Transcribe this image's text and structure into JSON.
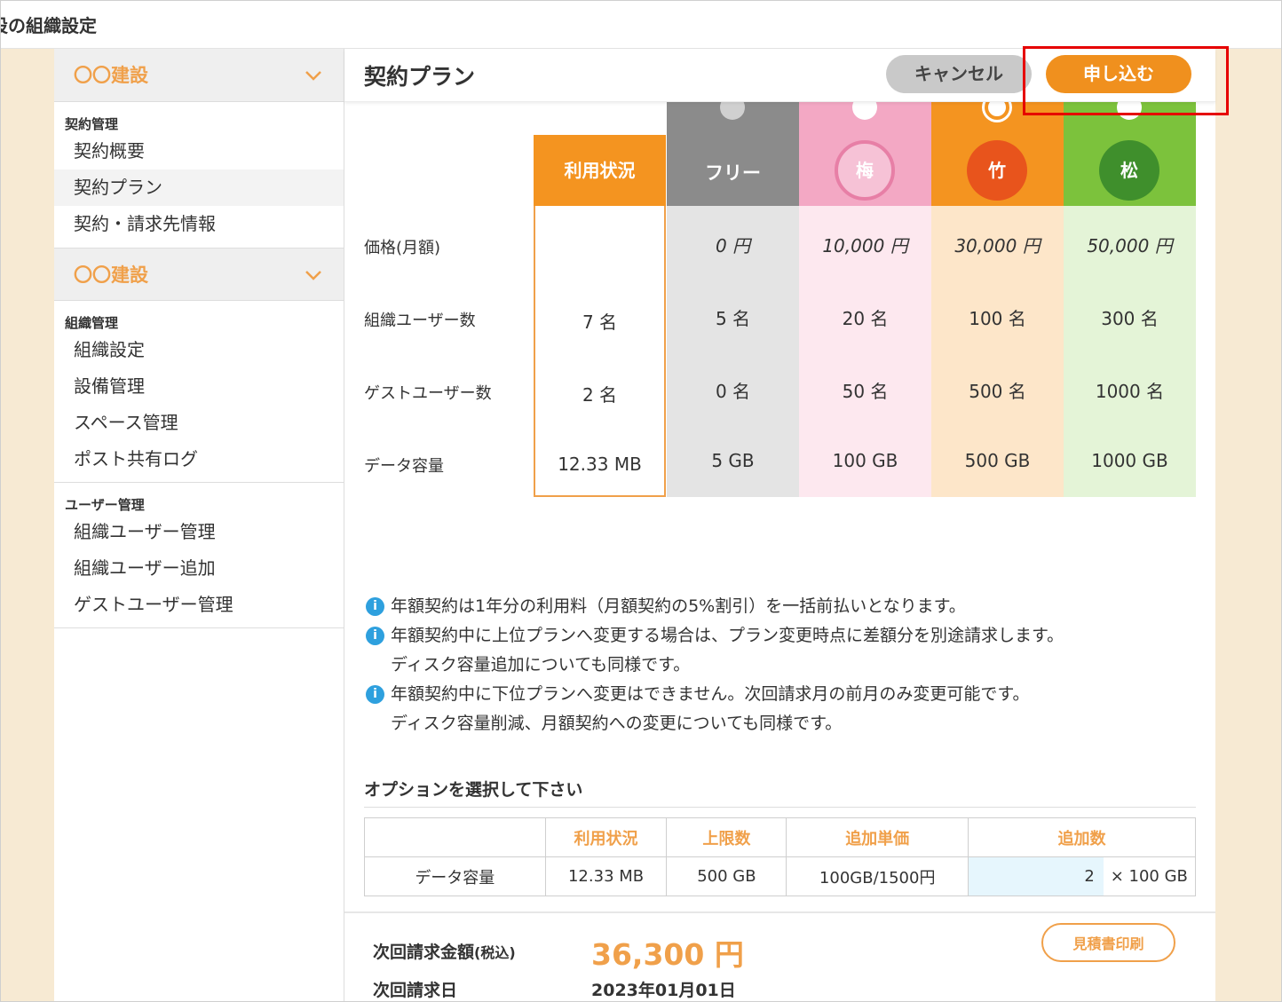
{
  "window": {
    "title": "設の組織設定"
  },
  "sidebar": {
    "orgs": [
      {
        "name": "〇〇建設"
      },
      {
        "name": "〇〇建設"
      }
    ],
    "sections": [
      {
        "label": "契約管理",
        "items": [
          "契約概要",
          "契約プラン",
          "契約・請求先情報"
        ]
      },
      {
        "label": "組織管理",
        "items": [
          "組織設定",
          "設備管理",
          "スペース管理",
          "ポスト共有ログ"
        ]
      },
      {
        "label": "ユーザー管理",
        "items": [
          "組織ユーザー管理",
          "組織ユーザー追加",
          "ゲストユーザー管理"
        ]
      }
    ],
    "active_item": "契約プラン"
  },
  "header": {
    "title": "契約プラン",
    "cancel_label": "キャンセル",
    "apply_label": "申し込む"
  },
  "plans": {
    "row_labels": [
      "価格(月額)",
      "組織ユーザー数",
      "ゲストユーザー数",
      "データ容量"
    ],
    "usage": {
      "header": "利用状況",
      "values": [
        "",
        "7 名",
        "2 名",
        "12.33 MB"
      ]
    },
    "columns": [
      {
        "header": "フリー",
        "icon": "",
        "price": "0 円",
        "users": "5 名",
        "guests": "0 名",
        "storage": "5 GB",
        "head_color": "#8b8b8b",
        "body_color": "#e4e4e4"
      },
      {
        "header": "",
        "icon": "梅",
        "price": "10,000 円",
        "users": "20 名",
        "guests": "50 名",
        "storage": "100 GB",
        "head_color": "#f3a8c4",
        "body_color": "#fde8ef"
      },
      {
        "header": "",
        "icon": "竹",
        "price": "30,000 円",
        "users": "100 名",
        "guests": "500 名",
        "storage": "500 GB",
        "head_color": "#f49420",
        "body_color": "#fde6c9"
      },
      {
        "header": "",
        "icon": "松",
        "price": "50,000 円",
        "users": "300 名",
        "guests": "1000 名",
        "storage": "1000 GB",
        "head_color": "#7cc23c",
        "body_color": "#e4f4d7"
      }
    ]
  },
  "notes": [
    {
      "text": "年額契約は1年分の利用料（月額契約の5%割引）を一括前払いとなります。",
      "cont": ""
    },
    {
      "text": "年額契約中に上位プランへ変更する場合は、プラン変更時点に差額分を別途請求します。",
      "cont": "ディスク容量追加についても同様です。"
    },
    {
      "text": "年額契約中に下位プランへ変更はできません。次回請求月の前月のみ変更可能です。",
      "cont": "ディスク容量削減、月額契約への変更についても同様です。"
    }
  ],
  "options": {
    "title": "オプションを選択して下さい",
    "headers": [
      "",
      "利用状況",
      "上限数",
      "追加単価",
      "追加数"
    ],
    "row": {
      "name": "データ容量",
      "usage": "12.33 MB",
      "limit": "500 GB",
      "unit_price": "100GB/1500円",
      "qty": "2",
      "qty_unit": "× 100 GB"
    }
  },
  "billing": {
    "amount_label": "次回請求金額",
    "tax_label": "(税込)",
    "amount": "36,300 円",
    "date_label": "次回請求日",
    "date": "2023年01月01日",
    "estimate_label": "見積書印刷"
  },
  "colors": {
    "accent": "#f0901e",
    "usage_border": "#f0a04a",
    "info": "#2ea0de",
    "highlight": "#e60000"
  }
}
